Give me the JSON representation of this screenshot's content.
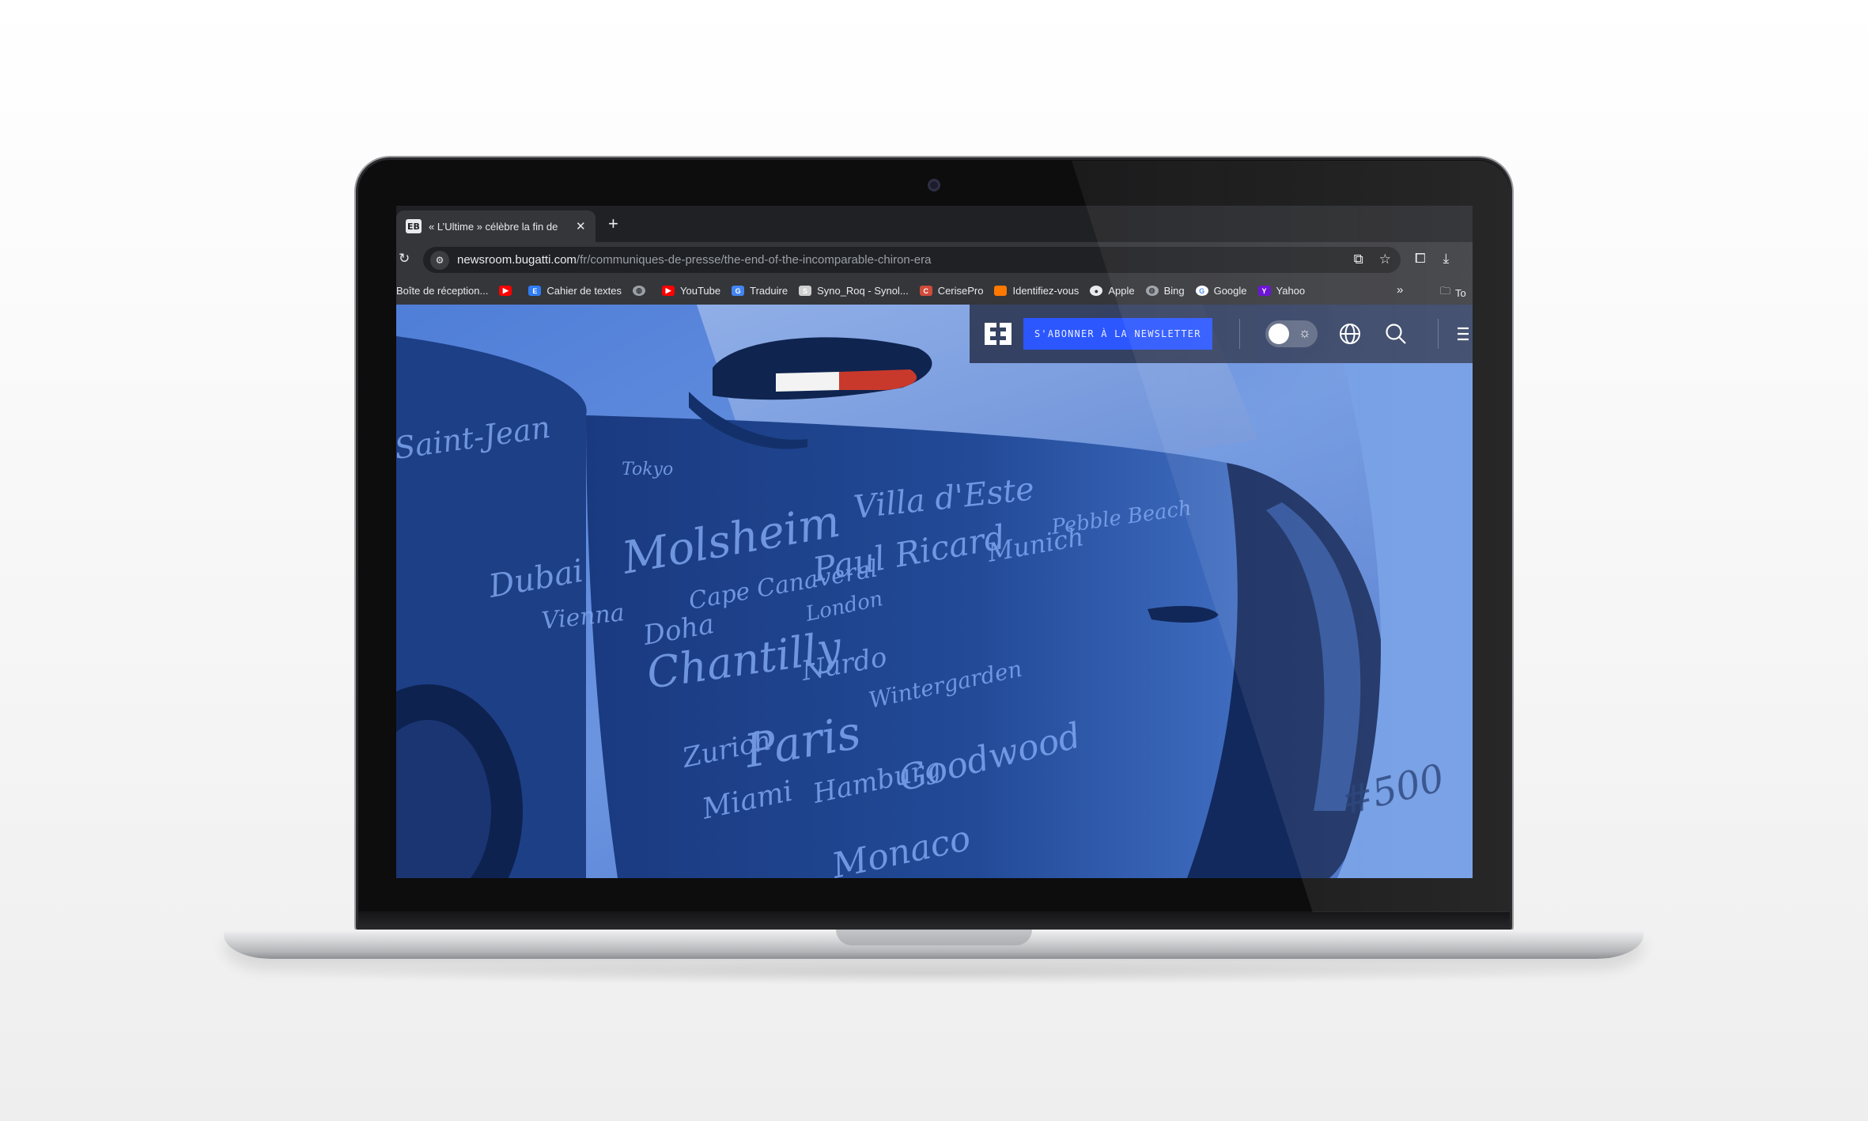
{
  "browser": {
    "tab": {
      "favicon": "bugatti-eb-logo",
      "title": "« L’Ultime » célèbre la fin de",
      "close_glyph": "✕",
      "new_tab_glyph": "+"
    },
    "url": {
      "host": "newsroom.bugatti.com",
      "path": "/fr/communiques-de-presse/the-end-of-the-incomparable-chiron-era"
    },
    "bookmarks": [
      {
        "label": "Boîte de réception...",
        "icon": "none",
        "color": ""
      },
      {
        "label": "",
        "icon": "youtube-icon",
        "color": "#ff0000"
      },
      {
        "label": "Cahier de textes",
        "icon": "ed-icon",
        "color": "#2e7cf6"
      },
      {
        "label": "",
        "icon": "globe-icon",
        "color": "#9aa0a6"
      },
      {
        "label": "YouTube",
        "icon": "youtube-icon",
        "color": "#ff0000"
      },
      {
        "label": "Traduire",
        "icon": "translate-icon",
        "color": "#4285f4"
      },
      {
        "label": "Syno_Roq - Synol...",
        "icon": "syno-icon",
        "color": "#cfcfcf"
      },
      {
        "label": "CerisePro",
        "icon": "cerise-icon",
        "color": "#d14b3b"
      },
      {
        "label": "Identifiez-vous",
        "icon": "orange-icon",
        "color": "#ff7900"
      },
      {
        "label": "Apple",
        "icon": "apple-icon",
        "color": "#e8eaed"
      },
      {
        "label": "Bing",
        "icon": "globe-icon",
        "color": "#9aa0a6"
      },
      {
        "label": "Google",
        "icon": "google-icon",
        "color": "#ffffff"
      },
      {
        "label": "Yahoo",
        "icon": "yahoo-icon",
        "color": "#6001d2"
      }
    ],
    "bookmarks_more": "»",
    "bookmarks_folder": "To"
  },
  "site": {
    "newsletter_label": "S'ABONNER À LA NEWSLETTER",
    "accent": "#2c57ff",
    "hero_words": [
      "Saint-Jean",
      "Tokyo",
      "Villa d'Este",
      "Molsheim",
      "Paul Ricard",
      "Dubai",
      "London",
      "Vienna",
      "Cape Canaveral",
      "Doha",
      "Chantilly",
      "Nardo",
      "Zurich",
      "Paris",
      "Miami",
      "Hamburg",
      "Goodwood",
      "Monaco",
      "Munich",
      "Pebble Beach",
      "Wintergarden",
      "#500"
    ]
  }
}
